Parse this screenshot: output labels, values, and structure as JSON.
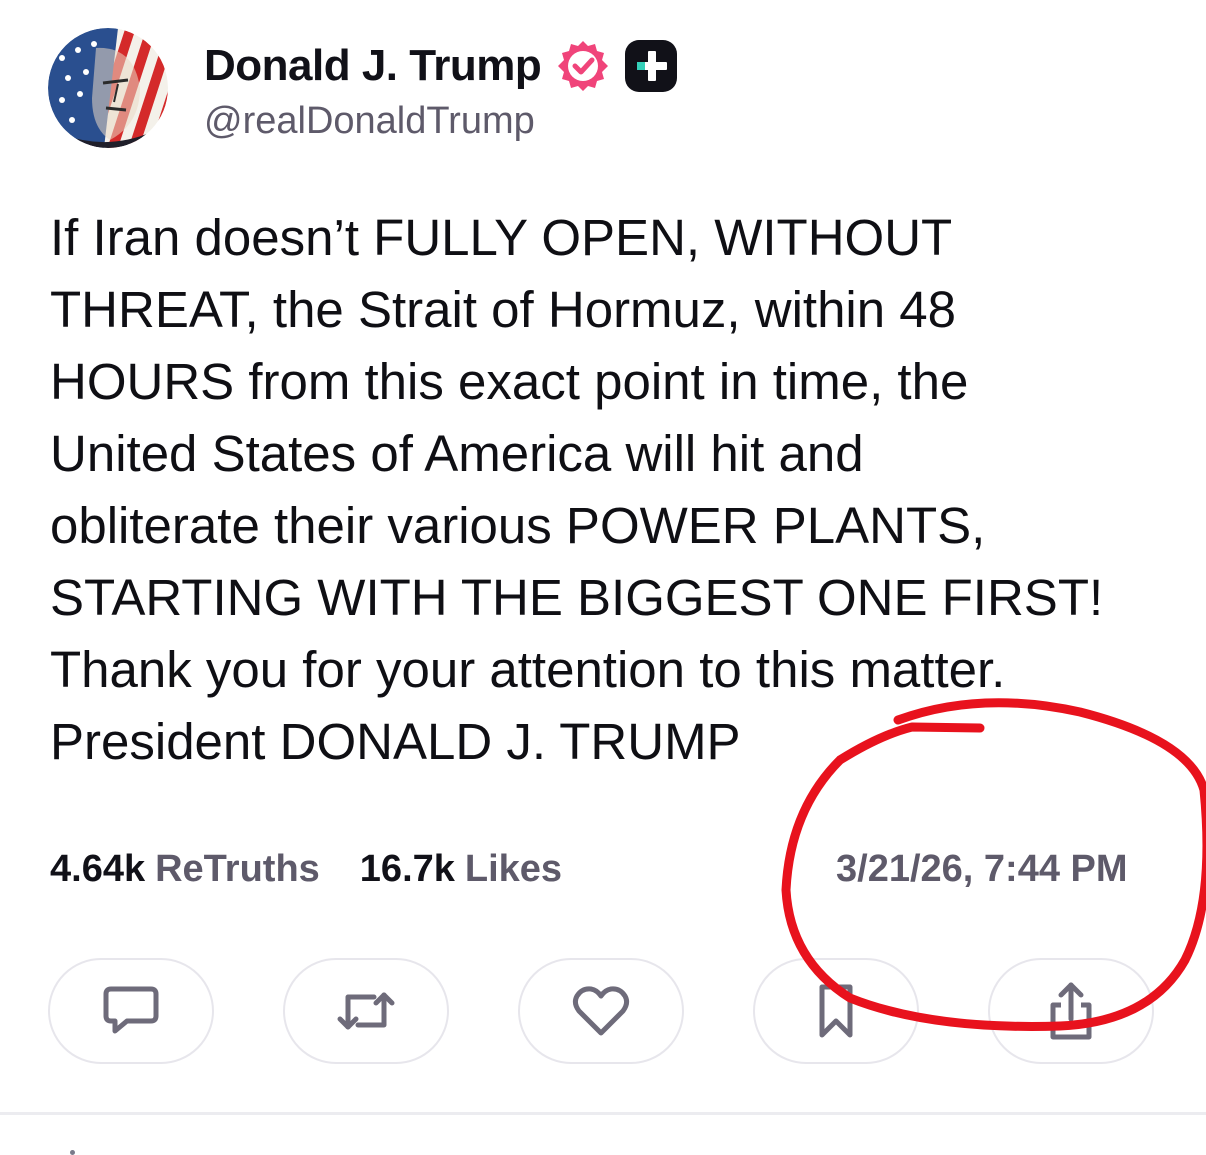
{
  "author": {
    "display_name": "Donald J. Trump",
    "handle": "@realDonaldTrump",
    "avatar": "avatar-image",
    "verified_badge": "verified-badge-icon",
    "plus_badge": "truth-plus-icon"
  },
  "post": {
    "lines": [
      "If Iran doesn’t FULLY OPEN, WITHOUT",
      "THREAT, the Strait of Hormuz, within 48",
      "HOURS from this exact point in time, the",
      "United States of America will hit and",
      "obliterate their various POWER PLANTS,",
      "STARTING WITH THE BIGGEST ONE FIRST!",
      "Thank you for your attention to this matter.",
      "President DONALD J. TRUMP"
    ]
  },
  "stats": {
    "retruths_count": "4.64k",
    "retruths_label": "ReTruths",
    "likes_count": "16.7k",
    "likes_label": "Likes"
  },
  "timestamp": "3/21/26, 7:44 PM",
  "actions": [
    {
      "name": "reply",
      "icon": "reply-icon"
    },
    {
      "name": "retruth",
      "icon": "retruth-icon"
    },
    {
      "name": "like",
      "icon": "heart-icon"
    },
    {
      "name": "bookmark",
      "icon": "bookmark-icon"
    },
    {
      "name": "share",
      "icon": "share-icon"
    }
  ],
  "colors": {
    "text_primary": "#111118",
    "text_secondary": "#5e5a6a",
    "verified_pink": "#f0447a",
    "icon_gray": "#6e6b7a",
    "button_border": "#e7e6ec",
    "annotation_red": "#e8121d"
  }
}
